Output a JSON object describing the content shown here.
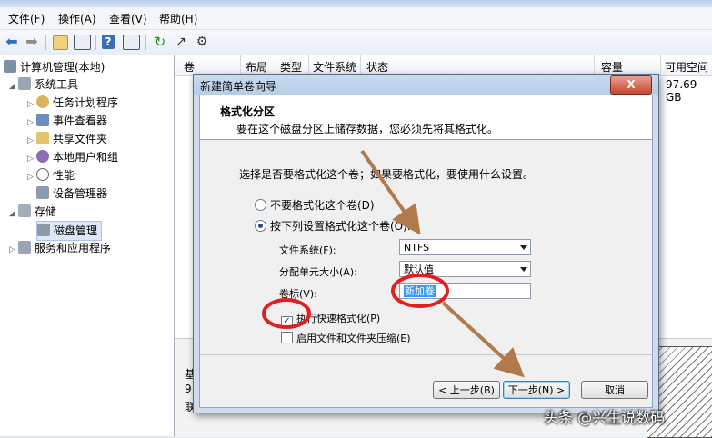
{
  "menu": {
    "items": [
      "文件(F)",
      "操作(A)",
      "查看(V)",
      "帮助(H)"
    ]
  },
  "toolbar": {
    "icons": [
      "back-arrow-icon",
      "forward-arrow-icon",
      "up-folder-icon",
      "show-hide-tree-icon",
      "help-icon",
      "properties-icon",
      "refresh-icon",
      "export-icon",
      "settings-icon"
    ]
  },
  "tree": {
    "root": "计算机管理(本地)",
    "system_tools": "系统工具",
    "task_scheduler": "任务计划程序",
    "event_viewer": "事件查看器",
    "shared_folders": "共享文件夹",
    "local_users": "本地用户和组",
    "performance": "性能",
    "device_manager": "设备管理器",
    "storage": "存储",
    "disk_management": "磁盘管理",
    "services_apps": "服务和应用程序"
  },
  "columns": {
    "volume": "卷",
    "layout": "布局",
    "type": "类型",
    "filesystem": "文件系统",
    "status": "状态",
    "capacity": "容量",
    "free_space": "可用空间"
  },
  "volume_row": {
    "free_space": "97.69 GB"
  },
  "lower_panel": {
    "line1": "基",
    "line2": "9",
    "line3": "联"
  },
  "dialog": {
    "title": "新建简单卷向导",
    "close_label": "X",
    "header_title": "格式化分区",
    "header_desc": "要在这个磁盘分区上储存数据，您必须先将其格式化。",
    "question": "选择是否要格式化这个卷；如果要格式化，要使用什么设置。",
    "radio_no_format": "不要格式化这个卷(D)",
    "radio_format": "按下列设置格式化这个卷(O):",
    "filesystem_label": "文件系统(F):",
    "filesystem_value": "NTFS",
    "alloc_label": "分配单元大小(A):",
    "alloc_value": "默认值",
    "volume_label_label": "卷标(V):",
    "volume_label_value": "新加卷",
    "quick_format": "执行快速格式化(P)",
    "compression": "启用文件和文件夹压缩(E)",
    "back_button": "< 上一步(B)",
    "next_button": "下一步(N) >",
    "cancel_button": "取消"
  },
  "watermark": "头条 @兴生说数码",
  "colors": {
    "annotation_red": "#e02020",
    "annotation_arrow": "#b07a4c",
    "selection_blue": "#3399ff"
  }
}
